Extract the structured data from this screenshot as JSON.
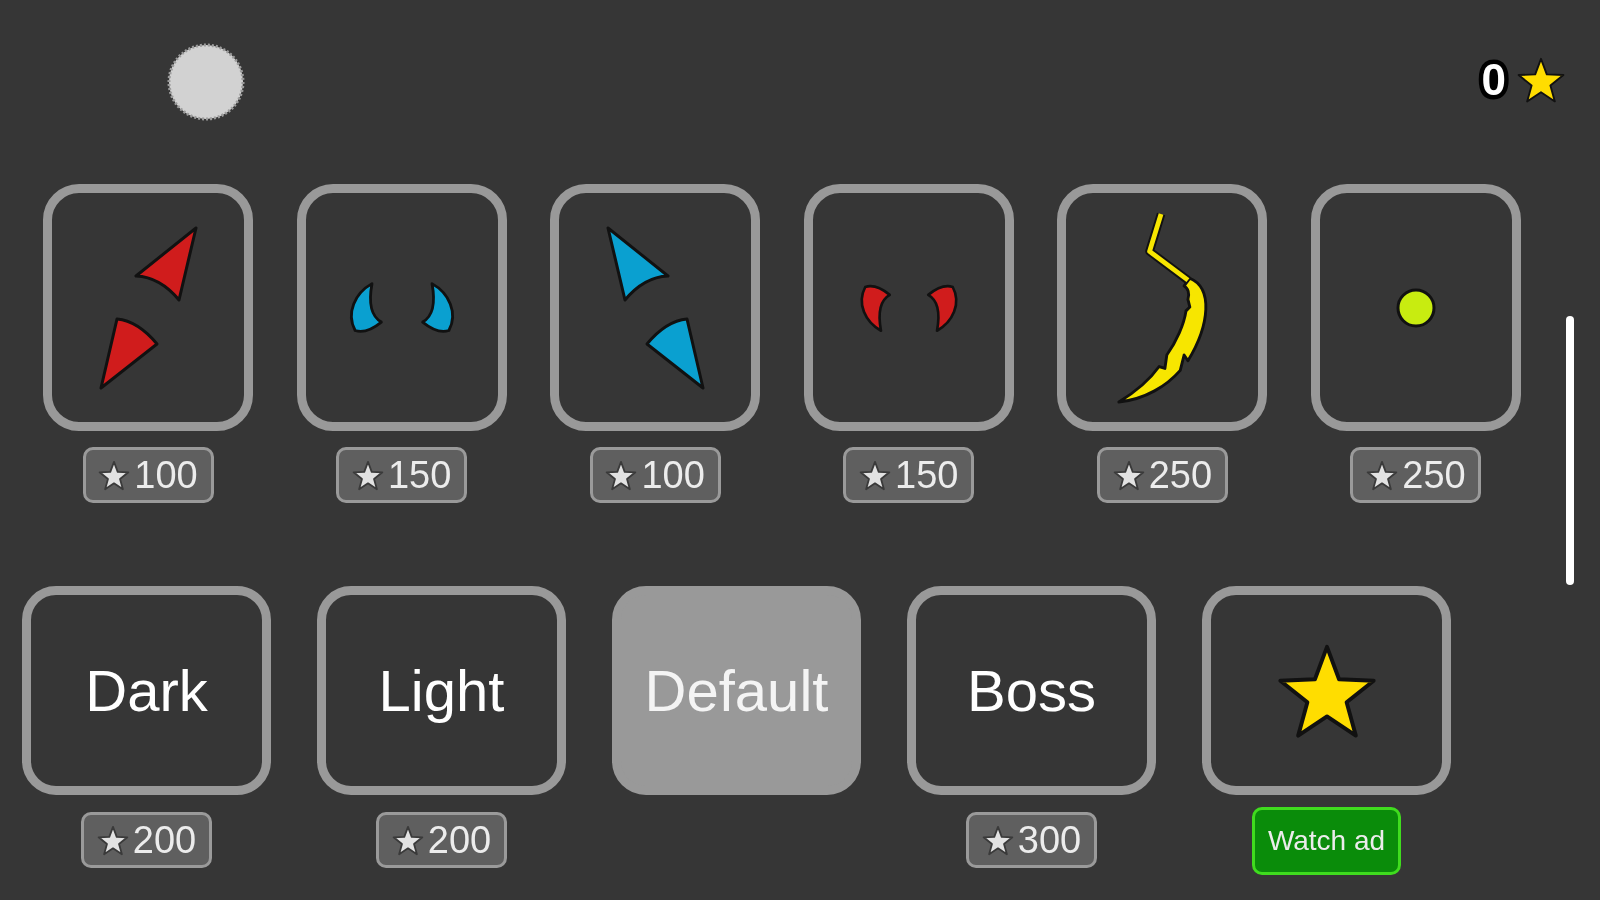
{
  "balance": {
    "amount": "0"
  },
  "skins": [
    {
      "kind": "slash",
      "color": "#d01c1c",
      "price": "100",
      "selected": false
    },
    {
      "kind": "horns",
      "color": "#0aa0d0",
      "price": "150",
      "selected": false
    },
    {
      "kind": "backslash",
      "color": "#0aa0d0",
      "price": "100",
      "selected": false
    },
    {
      "kind": "fangs",
      "color": "#d01c1c",
      "price": "150",
      "selected": false
    },
    {
      "kind": "tail",
      "color": "#f7e600",
      "price": "250",
      "selected": false
    },
    {
      "kind": "dot",
      "color": "#c8ec10",
      "price": "250",
      "selected": false
    }
  ],
  "themes": [
    {
      "kind": "label",
      "label": "Dark",
      "price": "200",
      "selected": false
    },
    {
      "kind": "label",
      "label": "Light",
      "price": "200",
      "selected": false
    },
    {
      "kind": "label",
      "label": "Default",
      "selected": true
    },
    {
      "kind": "label",
      "label": "Boss",
      "price": "300",
      "selected": false
    },
    {
      "kind": "star",
      "button": "Watch ad",
      "selected": false
    }
  ]
}
